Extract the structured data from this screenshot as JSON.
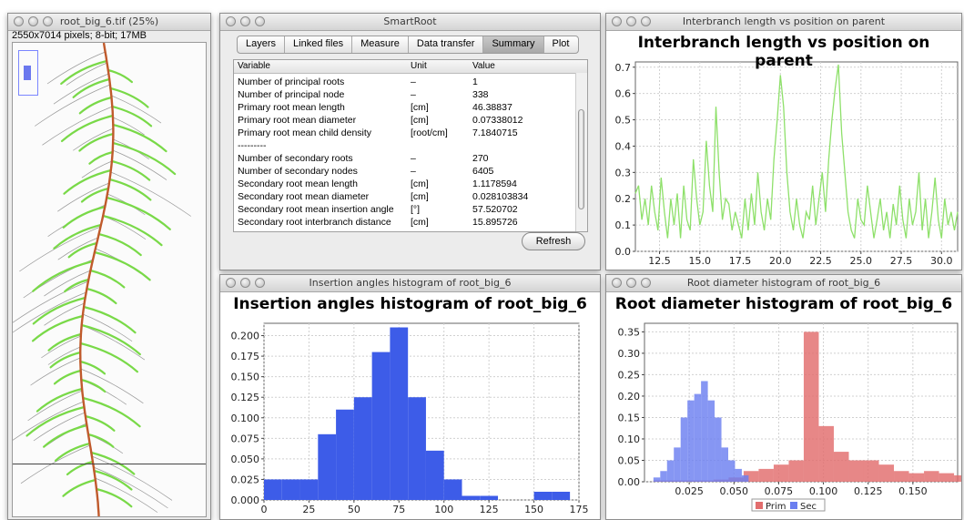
{
  "image_window": {
    "title": "root_big_6.tif (25%)",
    "info": "2550x7014 pixels; 8-bit; 17MB"
  },
  "smartroot": {
    "title": "SmartRoot",
    "tabs": [
      "Layers",
      "Linked files",
      "Measure",
      "Data transfer",
      "Summary",
      "Plot"
    ],
    "active_tab": "Summary",
    "columns": [
      "Variable",
      "Unit",
      "Value"
    ],
    "rows": [
      {
        "variable": "Number of principal roots",
        "unit": "–",
        "value": "1"
      },
      {
        "variable": "Number of principal node",
        "unit": "–",
        "value": "338"
      },
      {
        "variable": "Primary root mean length",
        "unit": "[cm]",
        "value": "46.38837"
      },
      {
        "variable": "Primary root mean diameter",
        "unit": "[cm]",
        "value": "0.07338012"
      },
      {
        "variable": "Primary root mean child density",
        "unit": "[root/cm]",
        "value": "7.1840715"
      },
      {
        "variable": "---------",
        "unit": "",
        "value": ""
      },
      {
        "variable": "Number of secondary roots",
        "unit": "–",
        "value": "270"
      },
      {
        "variable": "Number of secondary nodes",
        "unit": "–",
        "value": "6405"
      },
      {
        "variable": "Secondary root mean length",
        "unit": "[cm]",
        "value": "1.1178594"
      },
      {
        "variable": "Secondary root mean diameter",
        "unit": "[cm]",
        "value": "0.028103834"
      },
      {
        "variable": "Secondary root mean insertion angle",
        "unit": "[°]",
        "value": "57.520702"
      },
      {
        "variable": "Secondary root interbranch distance",
        "unit": "[cm]",
        "value": "15.895726"
      }
    ],
    "refresh_label": "Refresh"
  },
  "interbranch_window": {
    "title": "Interbranch length vs position on parent"
  },
  "insertion_window": {
    "title": "Insertion angles histogram of root_big_6"
  },
  "diameter_window": {
    "title": "Root diameter histogram of root_big_6"
  },
  "colors": {
    "line": "#8ee06a",
    "insertion_bar": "#3d5ce8",
    "prim": "#e26d6d",
    "sec": "#6b7ff0",
    "root_primary": "#c05a2c",
    "root_secondary": "#79d948"
  },
  "chart_data": [
    {
      "type": "line",
      "title": "Interbranch length vs position on parent",
      "xlim": [
        11,
        31
      ],
      "ylim": [
        0,
        0.72
      ],
      "xticks": [
        "12.5",
        "15.0",
        "17.5",
        "20.0",
        "22.5",
        "25.0",
        "27.5",
        "30.0"
      ],
      "yticks": [
        "0.0",
        "0.1",
        "0.2",
        "0.3",
        "0.4",
        "0.5",
        "0.6",
        "0.7"
      ],
      "x": [
        11.0,
        11.2,
        11.4,
        11.6,
        11.8,
        12.0,
        12.2,
        12.4,
        12.6,
        12.8,
        13.0,
        13.2,
        13.4,
        13.6,
        13.8,
        14.0,
        14.2,
        14.4,
        14.6,
        14.8,
        15.0,
        15.2,
        15.4,
        15.6,
        15.8,
        16.0,
        16.2,
        16.4,
        16.6,
        16.8,
        17.0,
        17.2,
        17.4,
        17.6,
        17.8,
        18.0,
        18.2,
        18.4,
        18.6,
        18.8,
        19.0,
        19.2,
        19.4,
        19.6,
        19.8,
        20.0,
        20.2,
        20.4,
        20.6,
        20.8,
        21.0,
        21.2,
        21.4,
        21.6,
        21.8,
        22.0,
        22.2,
        22.4,
        22.6,
        22.8,
        23.0,
        23.2,
        23.4,
        23.6,
        23.8,
        24.0,
        24.2,
        24.4,
        24.6,
        24.8,
        25.0,
        25.2,
        25.4,
        25.6,
        25.8,
        26.0,
        26.2,
        26.4,
        26.6,
        26.8,
        27.0,
        27.2,
        27.4,
        27.6,
        27.8,
        28.0,
        28.2,
        28.4,
        28.6,
        28.8,
        29.0,
        29.2,
        29.4,
        29.6,
        29.8,
        30.0,
        30.2,
        30.4,
        30.6,
        30.8,
        31.0
      ],
      "y": [
        0.22,
        0.25,
        0.12,
        0.2,
        0.1,
        0.25,
        0.15,
        0.08,
        0.28,
        0.15,
        0.05,
        0.2,
        0.1,
        0.22,
        0.05,
        0.25,
        0.12,
        0.08,
        0.35,
        0.2,
        0.1,
        0.15,
        0.42,
        0.25,
        0.15,
        0.55,
        0.3,
        0.12,
        0.2,
        0.18,
        0.08,
        0.15,
        0.1,
        0.05,
        0.2,
        0.08,
        0.22,
        0.1,
        0.3,
        0.15,
        0.08,
        0.2,
        0.12,
        0.35,
        0.5,
        0.67,
        0.55,
        0.3,
        0.15,
        0.08,
        0.2,
        0.1,
        0.05,
        0.15,
        0.12,
        0.25,
        0.1,
        0.2,
        0.3,
        0.15,
        0.35,
        0.5,
        0.62,
        0.71,
        0.45,
        0.3,
        0.15,
        0.08,
        0.05,
        0.2,
        0.12,
        0.1,
        0.25,
        0.15,
        0.05,
        0.12,
        0.2,
        0.08,
        0.15,
        0.05,
        0.18,
        0.1,
        0.25,
        0.12,
        0.05,
        0.2,
        0.1,
        0.15,
        0.3,
        0.08,
        0.2,
        0.05,
        0.15,
        0.28,
        0.12,
        0.05,
        0.2,
        0.1,
        0.15,
        0.08,
        0.15
      ]
    },
    {
      "type": "bar",
      "title": "Insertion angles histogram of root_big_6",
      "xlim": [
        0,
        175
      ],
      "ylim": [
        0,
        0.215
      ],
      "xticks": [
        "0",
        "25",
        "50",
        "75",
        "100",
        "125",
        "150",
        "175"
      ],
      "yticks": [
        "0.000",
        "0.025",
        "0.050",
        "0.075",
        "0.100",
        "0.125",
        "0.150",
        "0.175",
        "0.200"
      ],
      "bin_edges": [
        0,
        10,
        20,
        30,
        40,
        50,
        60,
        70,
        80,
        90,
        100,
        110,
        120,
        130,
        140,
        150,
        160,
        170
      ],
      "values": [
        0.025,
        0.025,
        0.025,
        0.08,
        0.11,
        0.125,
        0.18,
        0.21,
        0.125,
        0.06,
        0.025,
        0.005,
        0.005,
        0,
        0,
        0.01,
        0.01
      ],
      "xlabel": "",
      "ylabel": ""
    },
    {
      "type": "bar",
      "title": "Root diameter histogram of root_big_6",
      "xlim": [
        0,
        0.175
      ],
      "ylim": [
        0,
        0.37
      ],
      "xticks": [
        "0.025",
        "0.050",
        "0.075",
        "0.100",
        "0.125",
        "0.150"
      ],
      "yticks": [
        "0.00",
        "0.05",
        "0.10",
        "0.15",
        "0.20",
        "0.25",
        "0.30",
        "0.35"
      ],
      "legend": [
        "Prim",
        "Sec"
      ],
      "series": [
        {
          "name": "Prim",
          "bin_start": 0.005,
          "bin_width": 0.0084,
          "values": [
            0.003,
            0.003,
            0.003,
            0.003,
            0.005,
            0.01,
            0.025,
            0.03,
            0.04,
            0.05,
            0.35,
            0.13,
            0.07,
            0.05,
            0.05,
            0.04,
            0.025,
            0.02,
            0.025,
            0.02,
            0.015,
            0.01,
            0,
            0.005,
            0.01,
            0.005
          ]
        },
        {
          "name": "Sec",
          "bin_start": 0.005,
          "bin_width": 0.0038,
          "values": [
            0.01,
            0.025,
            0.05,
            0.08,
            0.15,
            0.19,
            0.205,
            0.235,
            0.19,
            0.15,
            0.08,
            0.05,
            0.03,
            0.015
          ]
        }
      ],
      "xlabel": "",
      "ylabel": ""
    }
  ]
}
